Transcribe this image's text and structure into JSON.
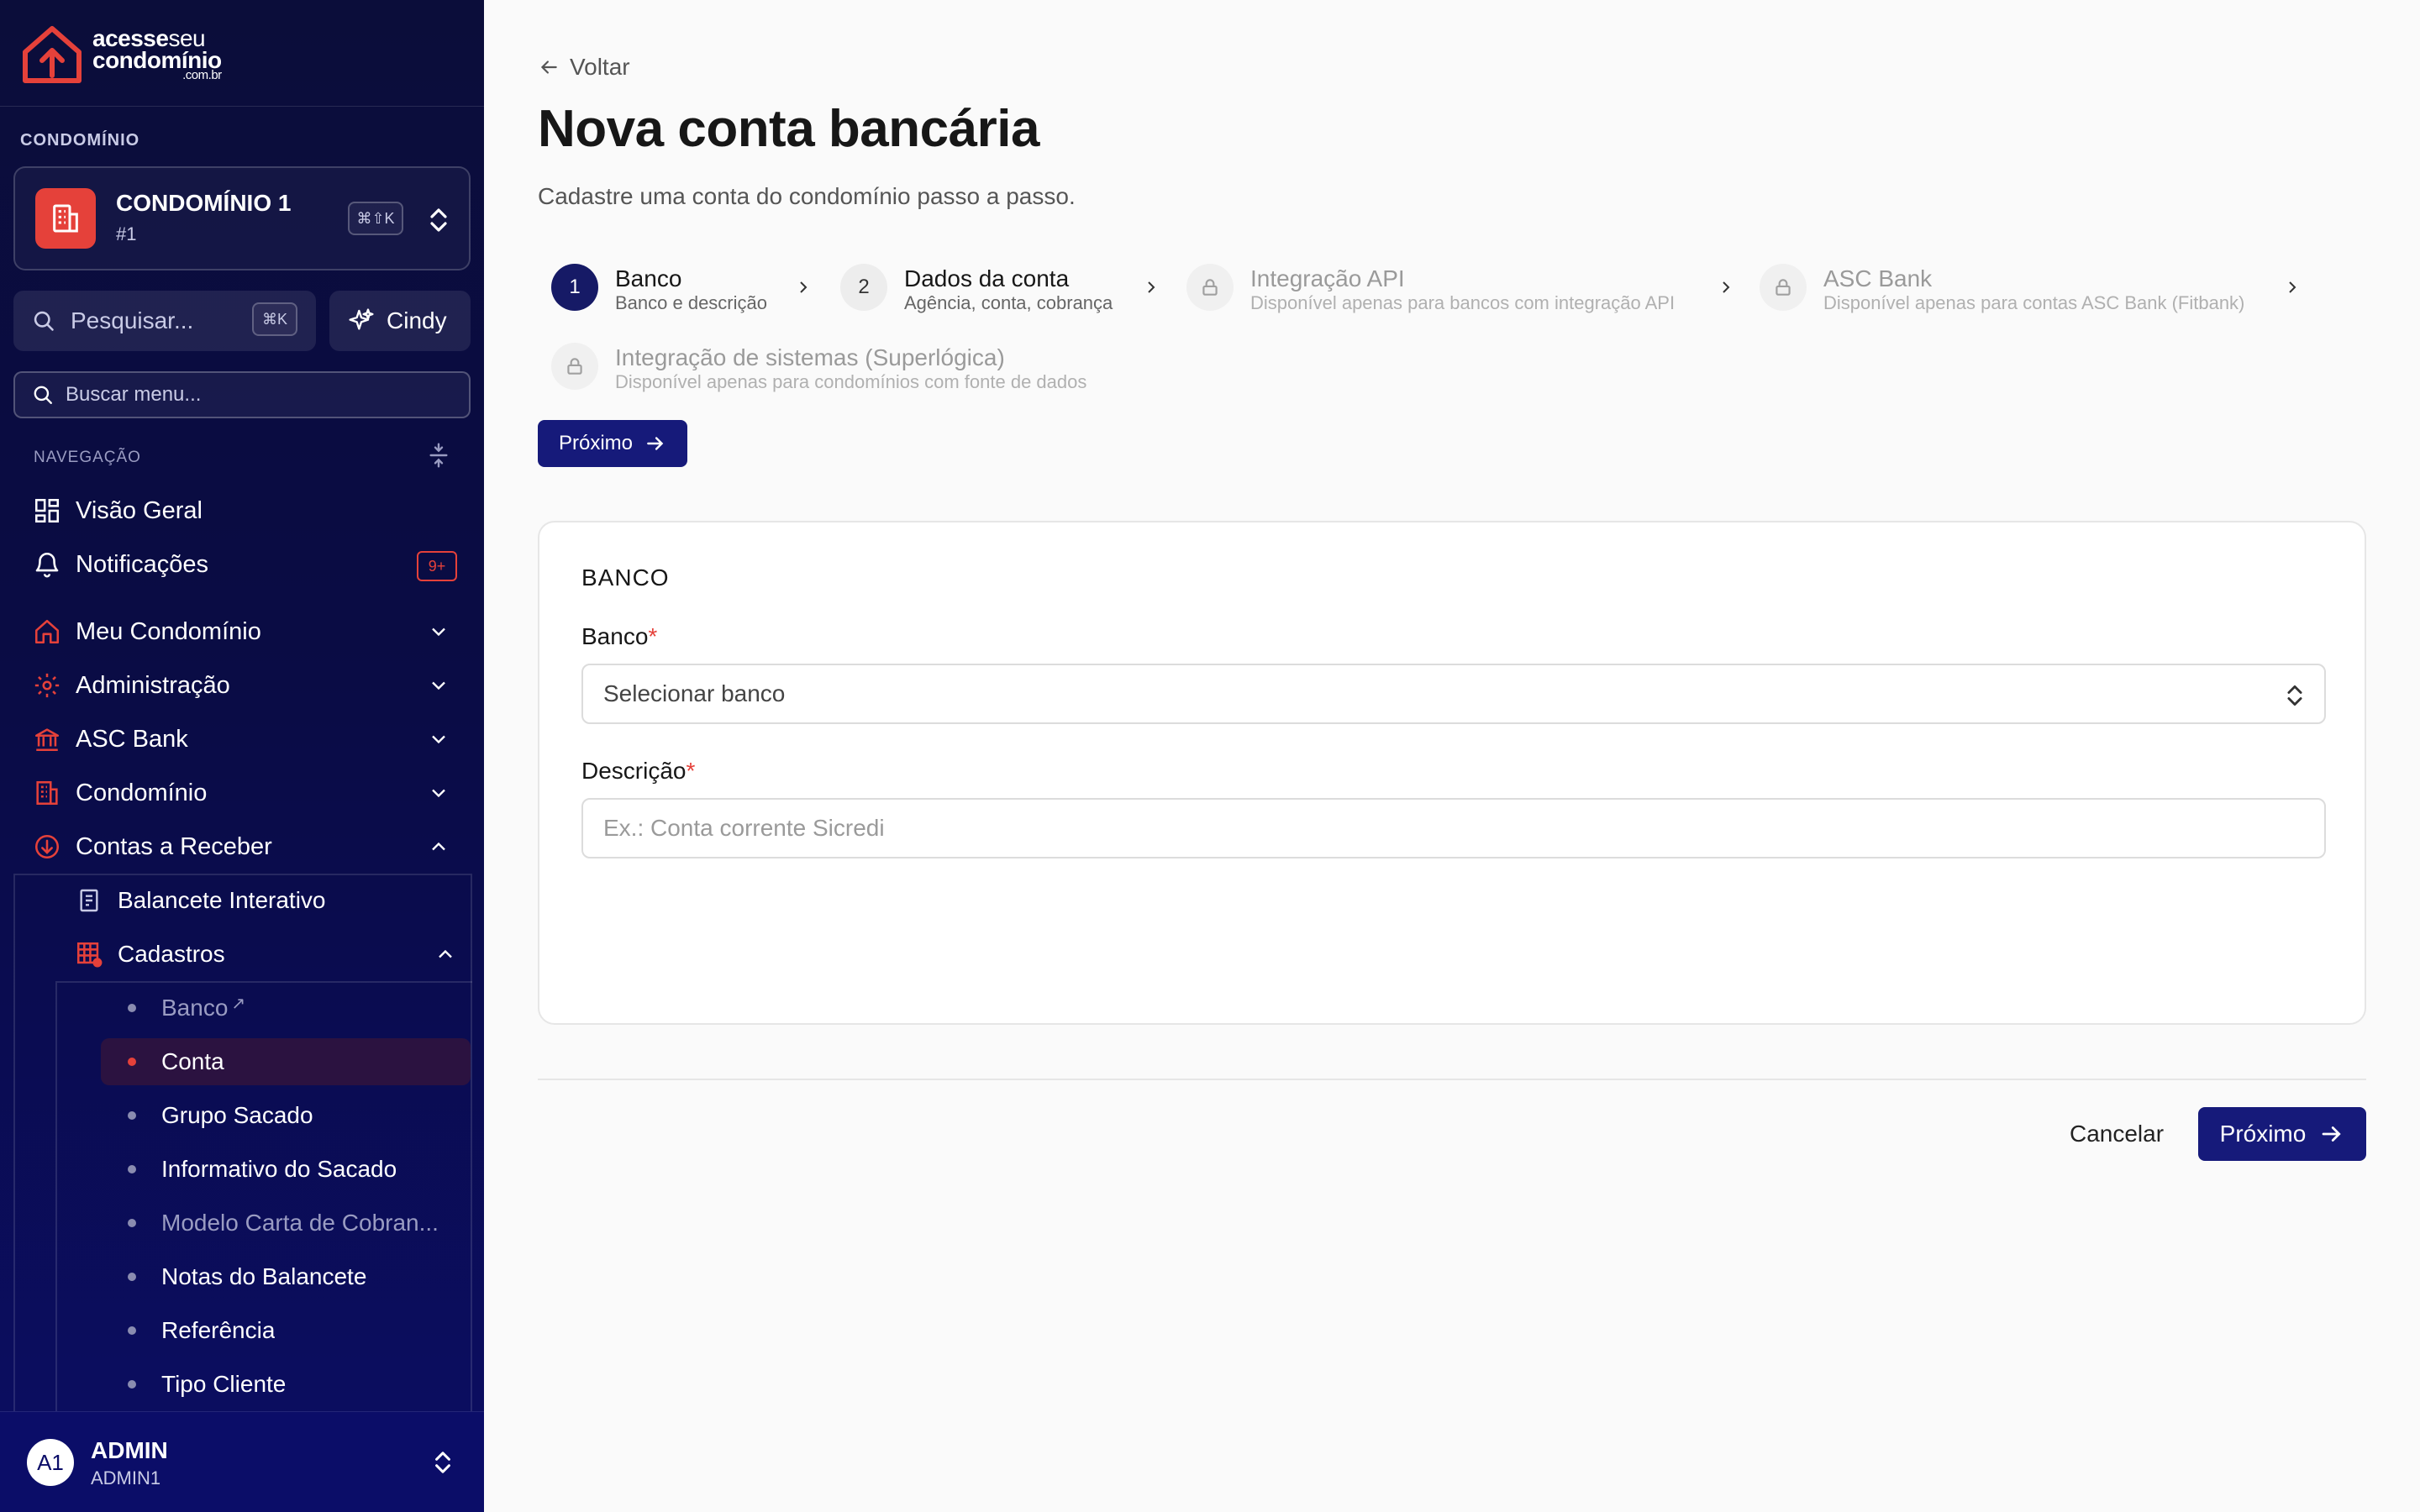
{
  "sidebar": {
    "logo": {
      "line1_bold": "acesse",
      "line1_thin": "seu",
      "line2": "condomínio",
      "line3": ".com.br"
    },
    "condominio_label": "CONDOMÍNIO",
    "condo": {
      "name": "CONDOMÍNIO 1",
      "number": "#1",
      "shortcut": "⌘⇧K"
    },
    "search": {
      "placeholder": "Pesquisar...",
      "shortcut": "⌘K"
    },
    "user_chip": "Cindy",
    "menu_search_placeholder": "Buscar menu...",
    "nav_label": "NAVEGAÇÃO",
    "items": [
      {
        "label": "Visão Geral",
        "icon": "grid-icon"
      },
      {
        "label": "Notificações",
        "icon": "bell-icon",
        "badge": "9+"
      },
      {
        "label": "Meu Condomínio",
        "icon": "home-icon"
      },
      {
        "label": "Administração",
        "icon": "gear-icon"
      },
      {
        "label": "ASC Bank",
        "icon": "bank-icon"
      },
      {
        "label": "Condomínio",
        "icon": "building-icon"
      },
      {
        "label": "Contas a Receber",
        "icon": "arrow-circle-icon"
      }
    ],
    "sub_items": [
      {
        "label": "Balancete Interativo",
        "icon": "document-icon"
      },
      {
        "label": "Cadastros",
        "icon": "table-icon"
      }
    ],
    "leaves": [
      {
        "label": "Banco",
        "state": "muted",
        "external": "↗"
      },
      {
        "label": "Conta",
        "state": "active"
      },
      {
        "label": "Grupo Sacado",
        "state": "normal"
      },
      {
        "label": "Informativo do Sacado",
        "state": "normal"
      },
      {
        "label": "Modelo Carta de Cobran...",
        "state": "muted"
      },
      {
        "label": "Notas do Balancete",
        "state": "normal"
      },
      {
        "label": "Referência",
        "state": "normal"
      },
      {
        "label": "Tipo Cliente",
        "state": "normal"
      }
    ],
    "footer": {
      "avatar": "A1",
      "name": "ADMIN",
      "sub": "ADMIN1"
    }
  },
  "main": {
    "back_label": "Voltar",
    "title": "Nova conta bancária",
    "subtitle": "Cadastre uma conta do condomínio passo a passo.",
    "steps": [
      {
        "num": "1",
        "title": "Banco",
        "desc": "Banco e descrição",
        "state": "active"
      },
      {
        "num": "2",
        "title": "Dados da conta",
        "desc": "Agência, conta, cobrança",
        "state": "todo"
      },
      {
        "title": "Integração API",
        "desc": "Disponível apenas para bancos com integração API",
        "state": "locked"
      },
      {
        "title": "ASC Bank",
        "desc": "Disponível apenas para contas ASC Bank (Fitbank)",
        "state": "locked"
      },
      {
        "title": "Integração de sistemas (Superlógica)",
        "desc": "Disponível apenas para condomínios com fonte de dados",
        "state": "locked"
      }
    ],
    "next_small": "Próximo",
    "card": {
      "title": "BANCO",
      "banco_label": "Banco",
      "banco_value": "Selecionar banco",
      "descricao_label": "Descrição",
      "descricao_placeholder": "Ex.: Conta corrente Sicredi",
      "required_mark": "*"
    },
    "cancel": "Cancelar",
    "next": "Próximo"
  },
  "colors": {
    "primary": "#161a7a",
    "accent": "#e5413a",
    "sidebar_bg": "#0b0d4a"
  }
}
